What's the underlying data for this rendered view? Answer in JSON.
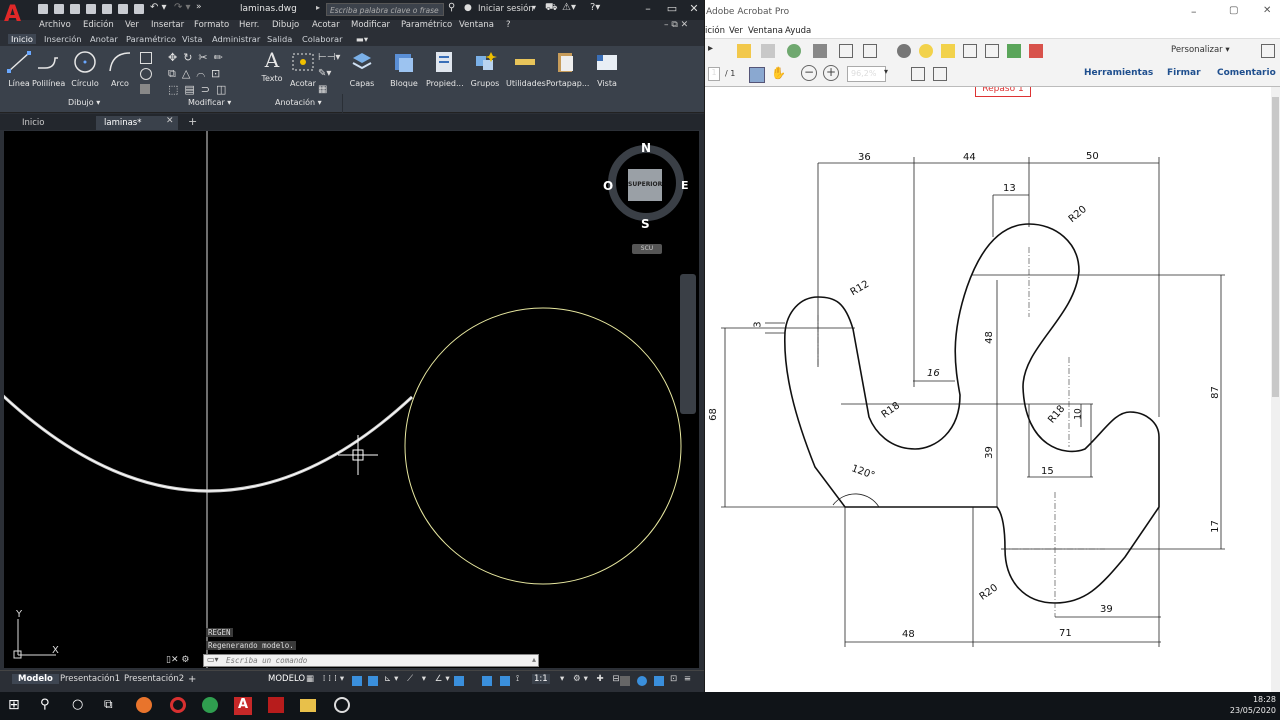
{
  "autocad": {
    "document_title": "laminas.dwg",
    "search_placeholder": "Escriba palabra clave o frase",
    "login": "Iniciar sesión",
    "menu": [
      "Archivo",
      "Edición",
      "Ver",
      "Insertar",
      "Formato",
      "Herr.",
      "Dibujo",
      "Acotar",
      "Modificar",
      "Paramétrico",
      "Ventana",
      "?"
    ],
    "ribbon_tabs": [
      "Inicio",
      "Inserción",
      "Anotar",
      "Paramétrico",
      "Vista",
      "Administrar",
      "Salida",
      "Colaborar"
    ],
    "tools": {
      "linea": "Línea",
      "polilinea": "Polilínea",
      "circulo": "Círculo",
      "arco": "Arco",
      "texto": "Texto",
      "acotar": "Acotar",
      "capas": "Capas",
      "bloque": "Bloque",
      "propiedades": "Propied...",
      "grupos": "Grupos",
      "utilidades": "Utilidades",
      "portapapeles": "Portapap...",
      "vista": "Vista"
    },
    "panels": {
      "dibujo": "Dibujo",
      "modificar": "Modificar",
      "anotacion": "Anotación"
    },
    "file_tabs": [
      "Inicio",
      "laminas*"
    ],
    "viewcube": {
      "n": "N",
      "s": "S",
      "e": "E",
      "o": "O",
      "face": "SUPERIOR",
      "wcs": "SCU"
    },
    "ucs": {
      "x": "X",
      "y": "Y"
    },
    "command_log": [
      "REGEN",
      "Regenerando modelo."
    ],
    "command_placeholder": "Escriba un comando",
    "status_tabs": [
      "Modelo",
      "Presentación1",
      "Presentación2"
    ],
    "status_model": "MODELO",
    "status_scale": "1:1"
  },
  "acrobat": {
    "title": "Adobe Acrobat Pro",
    "menu": [
      "ición",
      "Ver",
      "Ventana",
      "Ayuda"
    ],
    "customize": "Personalizar",
    "page": "1",
    "page_total": "/ 1",
    "zoom": "96,2%",
    "links": [
      "Herramientas",
      "Firmar",
      "Comentario"
    ],
    "stamp": "Repaso 1",
    "dims": {
      "d36": "36",
      "d44": "44",
      "d50": "50",
      "d13": "13",
      "r20a": "R20",
      "r12": "R12",
      "d3": "3",
      "d48v": "48",
      "d16": "16",
      "r18a": "R18",
      "r18b": "R18",
      "d10": "10",
      "d68": "68",
      "d87": "87",
      "d39": "39",
      "d15": "15",
      "a120": "120°",
      "d17": "17",
      "r20b": "R20",
      "d39b": "39",
      "d48h": "48",
      "d71": "71"
    }
  },
  "taskbar": {
    "time": "18:28",
    "date": "23/05/2020"
  }
}
